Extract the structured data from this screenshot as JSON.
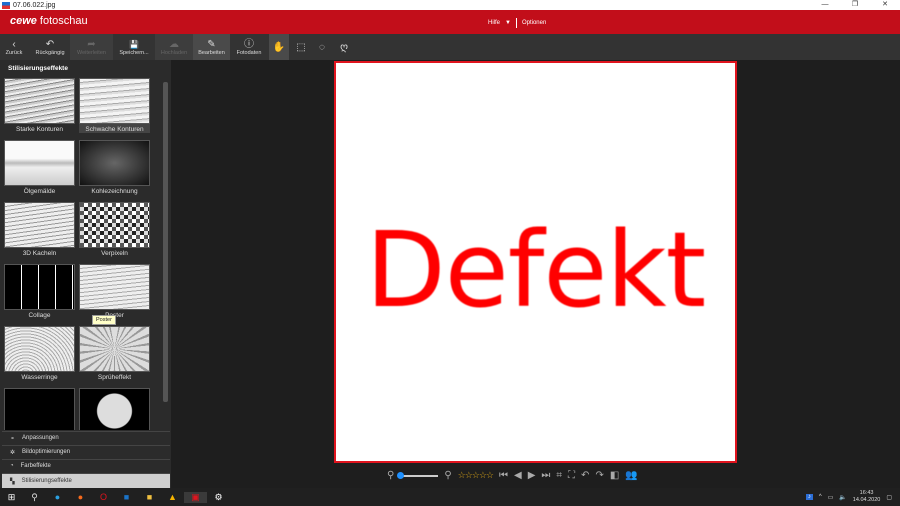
{
  "window": {
    "title": "07.06.022.jpg",
    "controls": [
      "—",
      "❐",
      "✕"
    ]
  },
  "header": {
    "brand": "cewe",
    "app": "fotoschau",
    "menu": [
      "Hilfe",
      "Optionen"
    ]
  },
  "toolbar": [
    {
      "label": "Zurück",
      "icon": "‹",
      "state": "normal"
    },
    {
      "label": "Rückgängig",
      "icon": "↶",
      "state": "normal"
    },
    {
      "label": "Weiterleiten",
      "icon": "➦",
      "state": "disabled"
    },
    {
      "label": "Speichern...",
      "icon": "💾",
      "state": "normal"
    },
    {
      "label": "Hochladen",
      "icon": "☁",
      "state": "disabled"
    },
    {
      "label": "Bearbeiten",
      "icon": "✎",
      "state": "active"
    },
    {
      "label": "Fotodaten",
      "icon": "ⓘ",
      "state": "normal"
    }
  ],
  "tools": [
    "hand",
    "rect-select",
    "ellipse-select",
    "lasso"
  ],
  "panel": {
    "title": "Stilisierungseffekte",
    "effects": [
      "Starke Konturen",
      "Schwache Konturen",
      "Ölgemälde",
      "Kohlezeichnung",
      "3D Kacheln",
      "Verpixeln",
      "Collage",
      "Poster",
      "Wasserringe",
      "Sprüheffekt",
      "",
      ""
    ],
    "selected": "Schwache Konturen",
    "tooltip": "Poster"
  },
  "accordion": [
    "Anpassungen",
    "Bildoptimierungen",
    "Farbeffekte",
    "Stilisierungseffekte"
  ],
  "photo": {
    "text": "Defekt",
    "border_color": "#e0141e"
  },
  "bottom": {
    "zoom_level": 0,
    "rating": 0,
    "stars": "☆☆☆☆☆"
  },
  "tray": {
    "time": "16:43",
    "date": "14.04.2020"
  },
  "colors": {
    "brand": "#c20e1a",
    "accent": "#1e90ff"
  }
}
